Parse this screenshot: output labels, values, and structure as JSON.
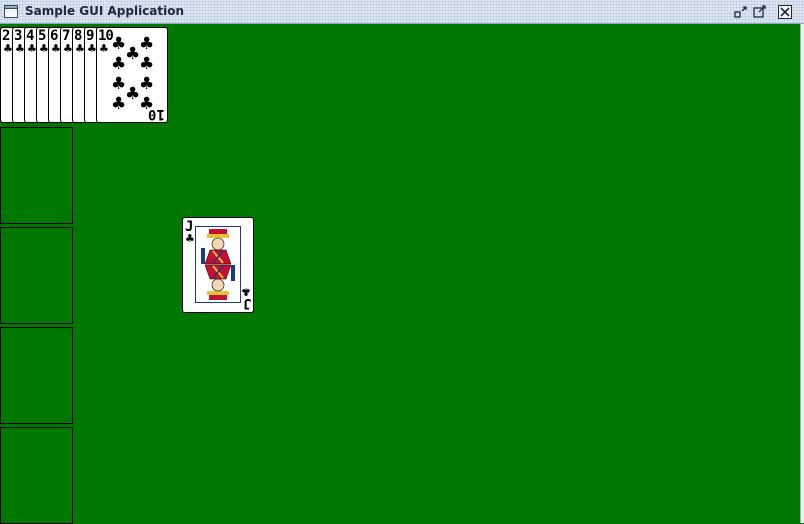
{
  "window": {
    "title": "Sample GUI Application"
  },
  "titlebar_icons": {
    "app": "window-icon",
    "minimize": "restore-down-icon",
    "maximize": "maximize-icon",
    "close": "close-icon"
  },
  "colors": {
    "table": "#007800",
    "card": "#ffffff"
  },
  "fan": {
    "suit_symbol": "♣",
    "cards": [
      {
        "rank": "2"
      },
      {
        "rank": "3"
      },
      {
        "rank": "4"
      },
      {
        "rank": "5"
      },
      {
        "rank": "6"
      },
      {
        "rank": "7"
      },
      {
        "rank": "8"
      },
      {
        "rank": "9"
      }
    ],
    "top_card": {
      "rank": "10",
      "suit_symbol": "♣"
    }
  },
  "piles": [
    {
      "name": "pile-1"
    },
    {
      "name": "pile-2"
    },
    {
      "name": "pile-3"
    },
    {
      "name": "pile-4"
    }
  ],
  "jack": {
    "rank": "J",
    "suit_symbol": "♣"
  }
}
